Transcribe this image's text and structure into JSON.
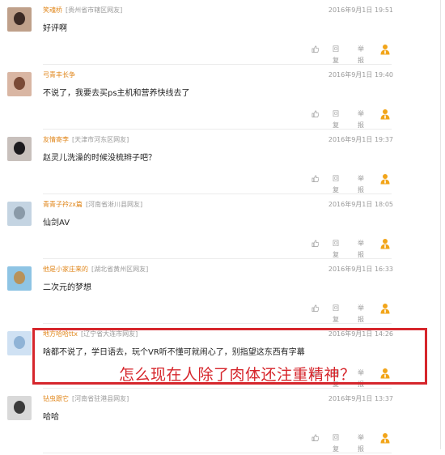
{
  "comments": [
    {
      "user": "笑魂桥",
      "location": "[贵州省市辖区网友]",
      "time": "2016年9月1日 19:51",
      "content": "好评啊",
      "reply": "回复",
      "report": "举报",
      "avatar_colors": [
        "#bfa08a",
        "#3c2a24"
      ]
    },
    {
      "user": "弓青丰长争",
      "location": "",
      "time": "2016年9月1日 19:40",
      "content": "不说了，我要去买ps主机和营养快线去了",
      "reply": "回复",
      "report": "举报",
      "avatar_colors": [
        "#d9b6a3",
        "#7a4a36"
      ]
    },
    {
      "user": "友情寄李",
      "location": "[天津市河东区网友]",
      "time": "2016年9月1日 19:37",
      "content": "赵灵儿洗澡的时候没梳辫子吧？",
      "reply": "回复",
      "report": "举报",
      "avatar_colors": [
        "#c8c0bc",
        "#1c1a1d"
      ]
    },
    {
      "user": "青青子衿zx篇",
      "location": "[河南省淅川县网友]",
      "time": "2016年9月1日 18:05",
      "content": "仙剑AV",
      "reply": "回复",
      "report": "举报",
      "avatar_colors": [
        "#c4d4e2",
        "#8a9aa8"
      ]
    },
    {
      "user": "他是小家庄来的",
      "location": "[湖北省黄州区网友]",
      "time": "2016年9月1日 16:33",
      "content": "二次元的梦想",
      "reply": "回复",
      "report": "举报",
      "avatar_colors": [
        "#8ec4e4",
        "#b8925a"
      ]
    },
    {
      "user": "地方哈哈ttx",
      "location": "[辽宁省大连市网友]",
      "time": "2016年9月1日 14:26",
      "content": "啥都不说了，学日语去，玩个VR听不懂可就闹心了，别指望这东西有字幕",
      "reply": "回复",
      "report": "举报",
      "avatar_colors": [
        "#cfe1f3",
        "#8fb3d6"
      ]
    },
    {
      "user": "钻虫跟它",
      "location": "[河南省驻港县网友]",
      "time": "2016年9月1日 13:37",
      "content": "哈哈",
      "reply": "回复",
      "report": "举报",
      "avatar_colors": [
        "#d9d9d9",
        "#3a3a3a"
      ]
    }
  ],
  "annotation": "怎么现在人除了肉体还注重精神？",
  "colors": {
    "username": "#e0861a",
    "meta": "#9a9a9a",
    "highlight": "#d6262c",
    "person_icon": "#f2a51a"
  }
}
